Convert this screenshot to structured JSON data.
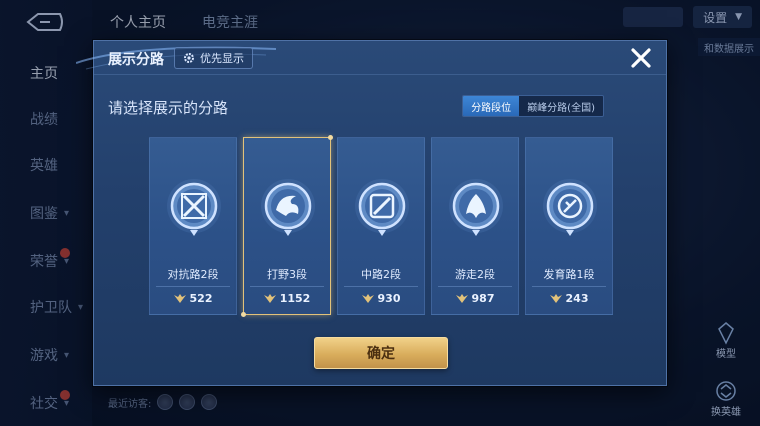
{
  "background": {
    "nav_items": [
      {
        "label": "主页",
        "active": true,
        "has_chevron": false,
        "badge": false
      },
      {
        "label": "战绩",
        "active": false,
        "has_chevron": false,
        "badge": false
      },
      {
        "label": "英雄",
        "active": false,
        "has_chevron": false,
        "badge": false
      },
      {
        "label": "图鉴",
        "active": false,
        "has_chevron": true,
        "badge": false
      },
      {
        "label": "荣誉",
        "active": false,
        "has_chevron": true,
        "badge": true
      },
      {
        "label": "护卫队",
        "active": false,
        "has_chevron": true,
        "badge": false
      },
      {
        "label": "游戏",
        "active": false,
        "has_chevron": true,
        "badge": false
      },
      {
        "label": "社交",
        "active": false,
        "has_chevron": true,
        "badge": true
      }
    ],
    "top_tabs": [
      {
        "label": "个人主页",
        "active": true
      },
      {
        "label": "电竞主涯",
        "active": false
      }
    ],
    "settings_label": "设置",
    "data_display_tag": "和数据展示",
    "model_label": "模型",
    "swap_hero_label": "换英雄",
    "visitors_label": "最近访客:"
  },
  "modal": {
    "title": "展示分路",
    "priority_button": "优先显示",
    "subtitle": "请选择展示的分路",
    "toggle": [
      {
        "label": "分路段位",
        "active": true
      },
      {
        "label": "巅峰分路(全国)",
        "active": false
      }
    ],
    "lanes": [
      {
        "label": "对抗路2段",
        "score": "522",
        "icon": "clash-lane-icon",
        "selected": false
      },
      {
        "label": "打野3段",
        "score": "1152",
        "icon": "jungle-icon",
        "selected": true
      },
      {
        "label": "中路2段",
        "score": "930",
        "icon": "mid-lane-icon",
        "selected": false
      },
      {
        "label": "游走2段",
        "score": "987",
        "icon": "roam-icon",
        "selected": false
      },
      {
        "label": "发育路1段",
        "score": "243",
        "icon": "farm-lane-icon",
        "selected": false
      }
    ],
    "confirm_label": "确定"
  },
  "colors": {
    "accent_gold": "#e2c27a",
    "toggle_active": "#3e86d6",
    "modal_bg": "#23406c"
  }
}
